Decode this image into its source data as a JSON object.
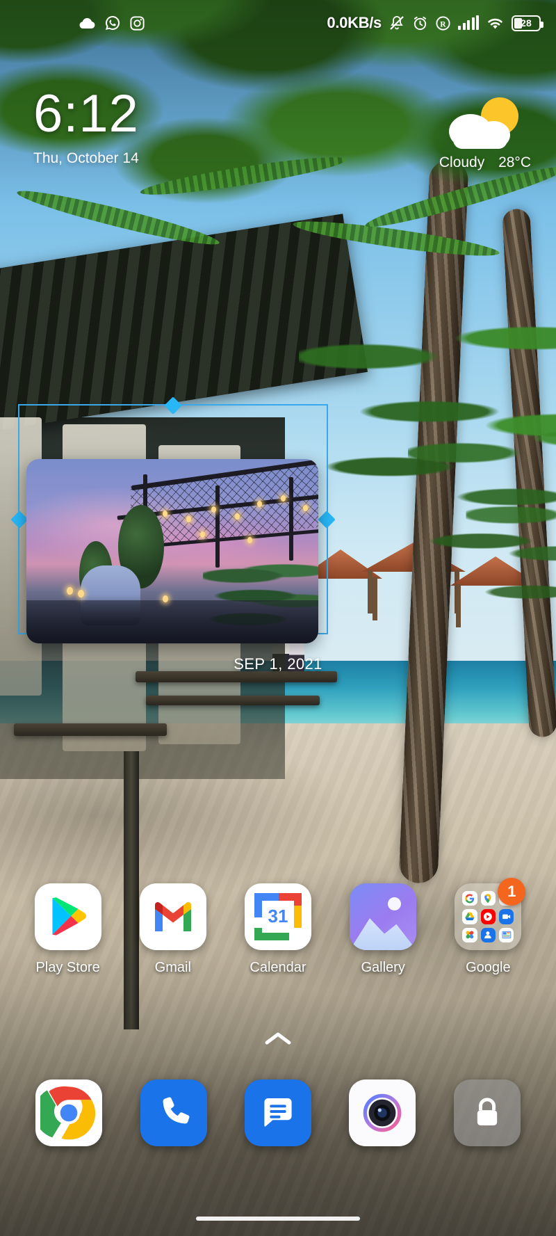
{
  "statusbar": {
    "left_icons": [
      "cloud-icon",
      "whatsapp-icon",
      "instagram-icon"
    ],
    "network_speed": "0.0KB/s",
    "right_icons": [
      "mute-icon",
      "alarm-icon",
      "dnd-icon",
      "signal-icon",
      "wifi-icon"
    ],
    "battery_level": "28"
  },
  "clock_widget": {
    "time": "6:12",
    "date": "Thu, October 14"
  },
  "weather_widget": {
    "icon": "partly-cloudy-icon",
    "condition": "Cloudy",
    "temperature": "28°C"
  },
  "photo_widget": {
    "caption": "SEP 1, 2021",
    "resize_mode": true,
    "frame_color": "#39a7e8",
    "handle_color": "#28b6f6"
  },
  "app_grid": [
    {
      "label": "Play Store",
      "icon": "play-store-icon"
    },
    {
      "label": "Gmail",
      "icon": "gmail-icon"
    },
    {
      "label": "Calendar",
      "icon": "calendar-icon",
      "day": "31"
    },
    {
      "label": "Gallery",
      "icon": "gallery-icon"
    },
    {
      "label": "Google",
      "icon": "google-folder-icon",
      "badge": "1",
      "folder_apps": [
        "google-search-icon",
        "google-maps-icon",
        "youtube-icon",
        "google-drive-icon",
        "youtube-music-icon",
        "google-meet-icon",
        "google-photos-icon",
        "google-contacts-icon",
        "google-news-icon"
      ]
    }
  ],
  "page_indicator": {
    "icon": "chevron-up-icon"
  },
  "dock": [
    {
      "label": "Chrome",
      "icon": "chrome-icon"
    },
    {
      "label": "Phone",
      "icon": "phone-icon"
    },
    {
      "label": "Messages",
      "icon": "messages-icon"
    },
    {
      "label": "Camera",
      "icon": "camera-icon"
    },
    {
      "label": "Lock",
      "icon": "lock-icon"
    }
  ],
  "navigation": {
    "icon": "home-gesture-pill"
  }
}
